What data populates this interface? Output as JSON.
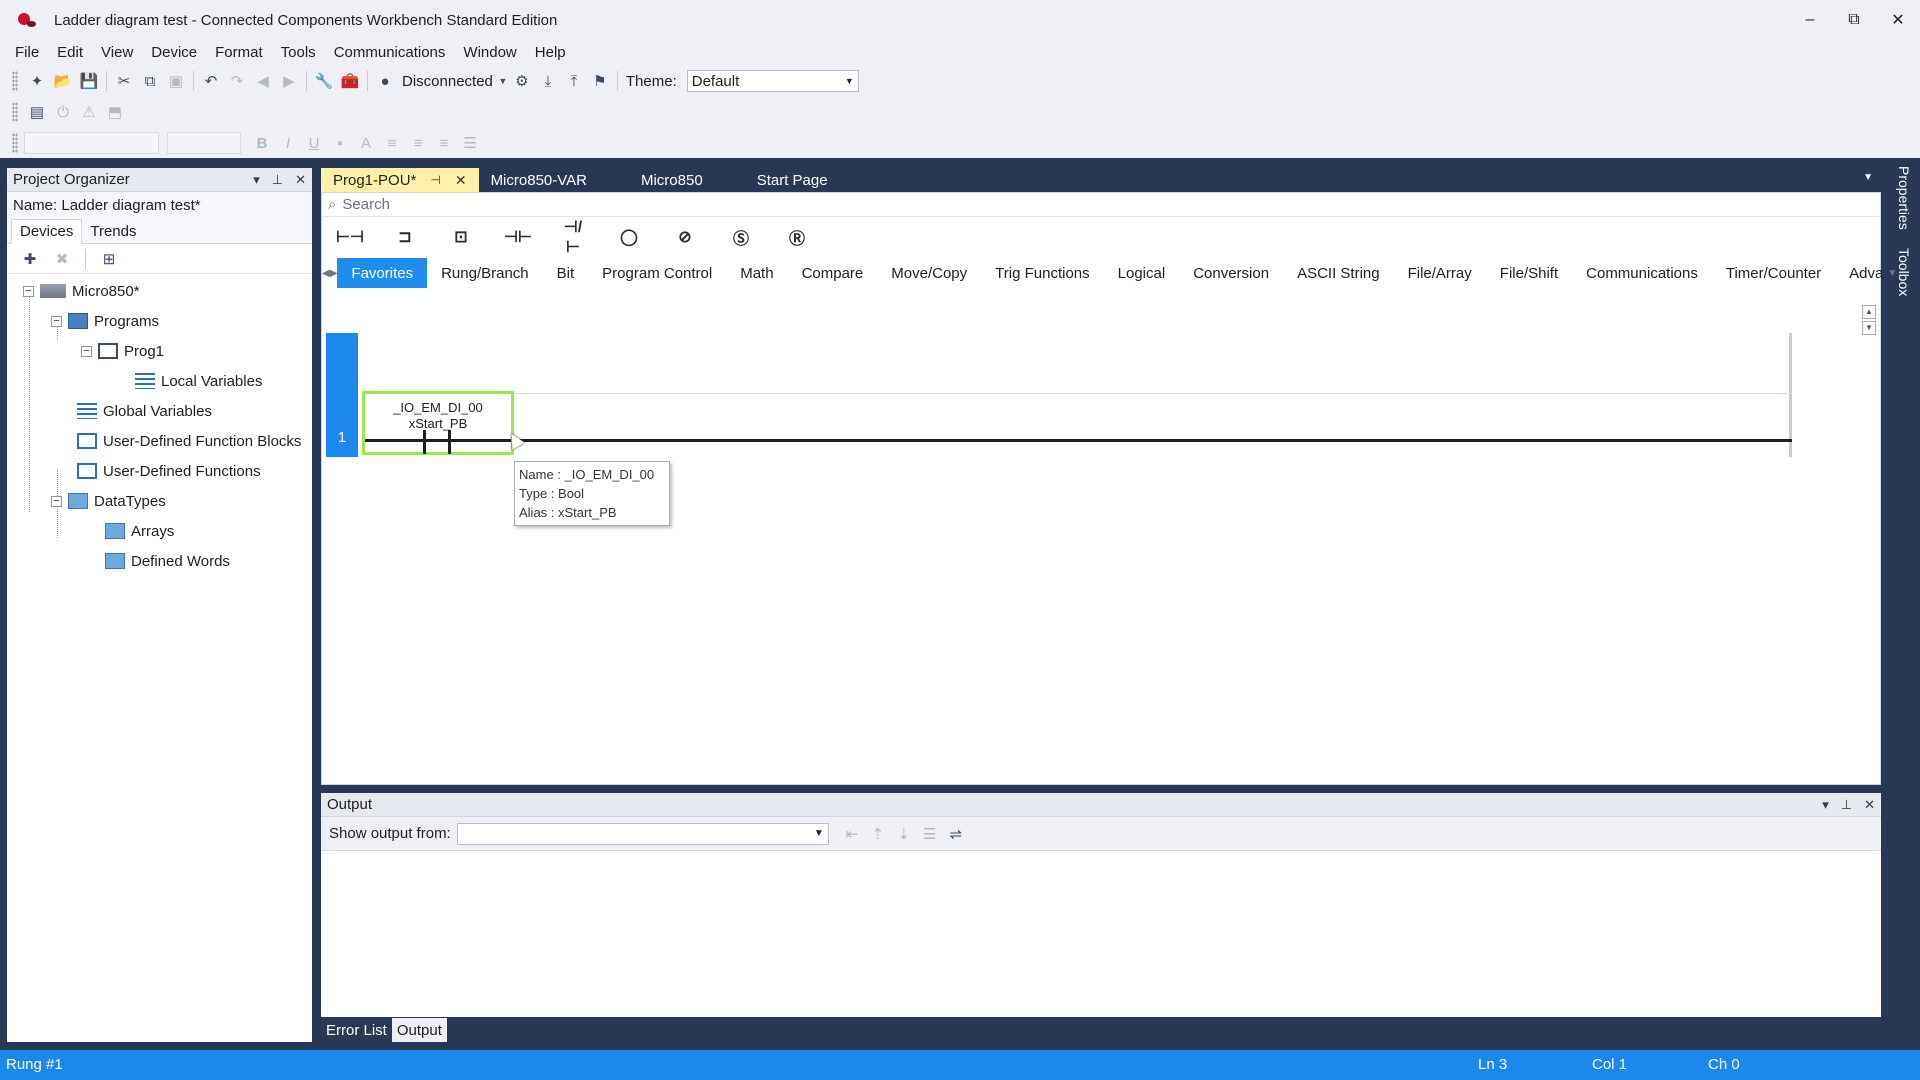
{
  "window": {
    "title": "Ladder diagram test - Connected Components Workbench Standard Edition",
    "controls": [
      "–",
      "⧉",
      "✕"
    ]
  },
  "menu": [
    "File",
    "Edit",
    "View",
    "Device",
    "Format",
    "Tools",
    "Communications",
    "Window",
    "Help"
  ],
  "toolbar": {
    "connection_status": "Disconnected",
    "theme_label": "Theme:",
    "theme_value": "Default"
  },
  "project_organizer": {
    "title": "Project Organizer",
    "name_label": "Name:  Ladder diagram test*",
    "tabs": [
      "Devices",
      "Trends"
    ],
    "tree": [
      "Micro850*",
      "Programs",
      "Prog1",
      "Local Variables",
      "Global Variables",
      "User-Defined Function Blocks",
      "User-Defined Functions",
      "DataTypes",
      "Arrays",
      "Defined Words"
    ]
  },
  "doc_tabs": [
    "Prog1-POU*",
    "Micro850-VAR",
    "Micro850",
    "Start Page"
  ],
  "editor": {
    "search_placeholder": "Search",
    "categories": [
      "Favorites",
      "Rung/Branch",
      "Bit",
      "Program Control",
      "Math",
      "Compare",
      "Move/Copy",
      "Trig Functions",
      "Logical",
      "Conversion",
      "ASCII String",
      "File/Array",
      "File/Shift",
      "Communications",
      "Timer/Counter",
      "Adva"
    ],
    "active_category": "Favorites",
    "rung_number": "1",
    "contact": {
      "variable": "_IO_EM_DI_00",
      "alias": "xStart_PB"
    },
    "tooltip": {
      "name": "Name : _IO_EM_DI_00",
      "type": "Type : Bool",
      "alias": "Alias : xStart_PB"
    }
  },
  "output_panel": {
    "title": "Output",
    "show_from_label": "Show output from:",
    "show_from_value": ""
  },
  "bottom_tabs": [
    "Error List",
    "Output"
  ],
  "side_tabs": [
    "Properties",
    "Toolbox"
  ],
  "status": {
    "rung": "Rung #1",
    "ln": "Ln 3",
    "col": "Col 1",
    "ch": "Ch 0"
  },
  "colors": {
    "accent": "#1c87ec",
    "frame": "#293955",
    "active_tab": "#fff1a8",
    "contact_highlight": "#9be84d"
  }
}
